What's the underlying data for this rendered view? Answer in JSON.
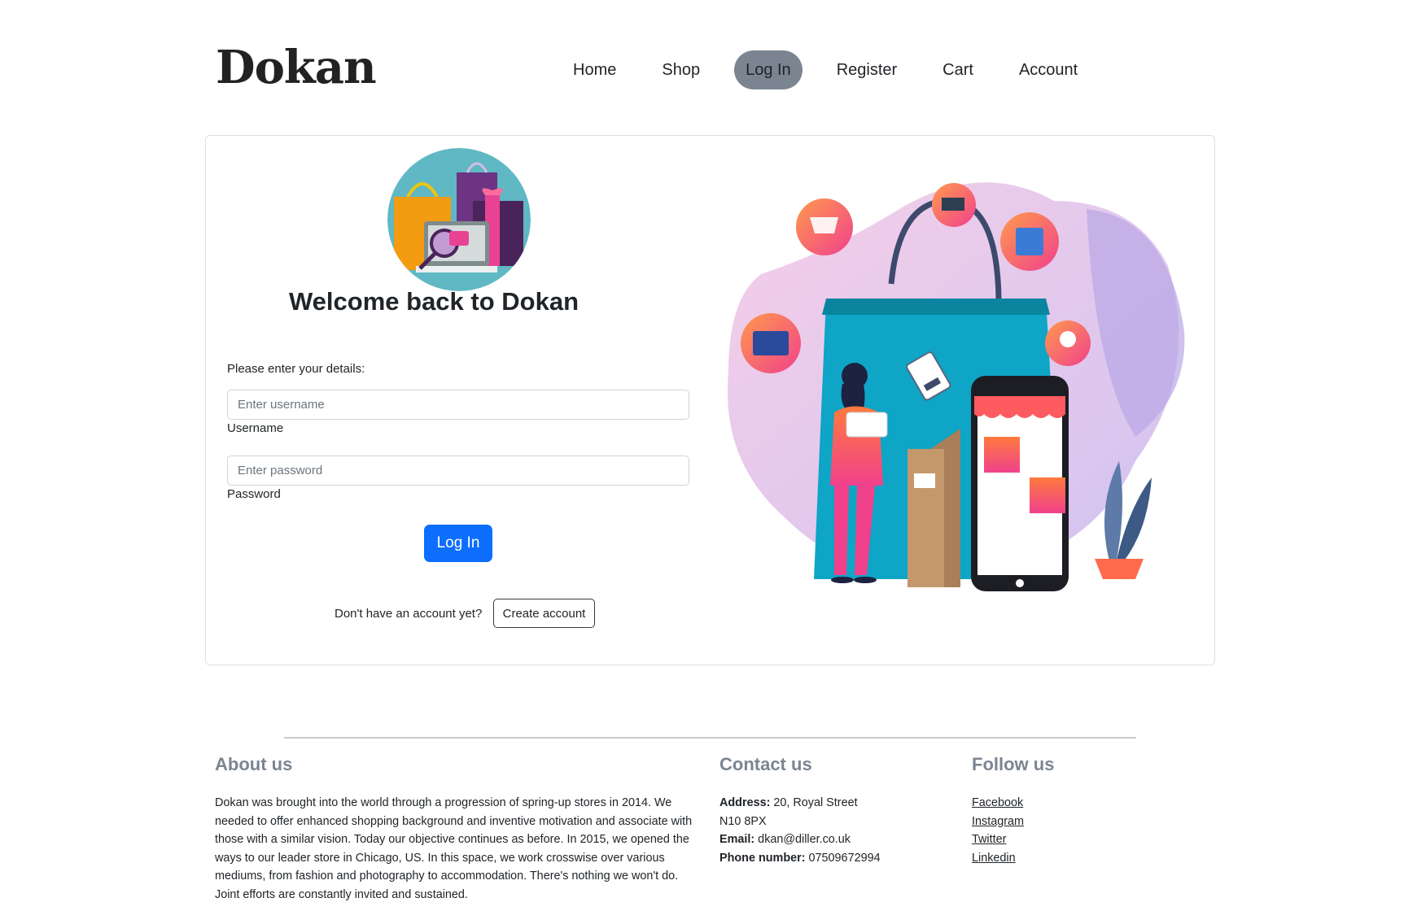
{
  "header": {
    "logo": "Dokan",
    "nav": [
      {
        "label": "Home",
        "active": false
      },
      {
        "label": "Shop",
        "active": false
      },
      {
        "label": "Log In",
        "active": true
      },
      {
        "label": "Register",
        "active": false
      },
      {
        "label": "Cart",
        "active": false
      },
      {
        "label": "Account",
        "active": false
      }
    ]
  },
  "login": {
    "welcome": "Welcome back to Dokan",
    "prompt": "Please enter your details:",
    "username_placeholder": "Enter username",
    "username_label": "Username",
    "password_placeholder": "Enter password",
    "password_label": "Password",
    "submit_label": "Log In",
    "no_account_text": "Don't have an account yet?",
    "create_account_label": "Create account"
  },
  "footer": {
    "about": {
      "title": "About us",
      "text": "Dokan was brought into the world through a progression of spring-up stores in 2014. We needed to offer enhanced shopping background and inventive motivation and associate with those with a similar vision. Today our objective continues as before. In 2015, we opened the ways to our leader store in Chicago, US. In this space, we work crosswise over various mediums, from fashion and photography to accommodation. There's nothing we won't do. Joint efforts are constantly invited and sustained."
    },
    "contact": {
      "title": "Contact us",
      "address_label": "Address:",
      "address_line1": " 20, Royal Street",
      "address_line2": "N10 8PX",
      "email_label": "Email:",
      "email": " dkan@diller.co.uk",
      "phone_label": "Phone number:",
      "phone": " 07509672994"
    },
    "follow": {
      "title": "Follow us",
      "links": [
        "Facebook",
        "Instagram",
        "Twitter",
        "Linkedin"
      ]
    }
  },
  "colors": {
    "primary": "#0d6efd",
    "nav_active_bg": "#7b8591",
    "footer_heading": "#7b8591"
  }
}
